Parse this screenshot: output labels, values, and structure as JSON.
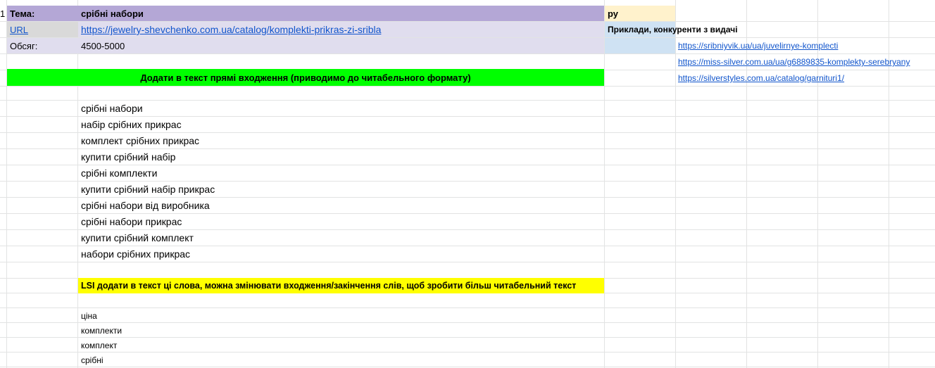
{
  "sheet": {
    "row_number": "1",
    "topic": {
      "label": "Тема:",
      "value": "срібні набори"
    },
    "url": {
      "label": "URL",
      "value": "https://jewelry-shevchenko.com.ua/catalog/komplekti-prikras-zi-sribla"
    },
    "volume": {
      "label": "Обсяг:",
      "value": "4500-5000"
    },
    "lang_label": "ру",
    "competitors": {
      "header": "Приклади, конкуренти з видачі",
      "links": [
        "https://sribniyvik.ua/ua/juvelirnye-komplecti",
        "https://miss-silver.com.ua/ua/g6889835-komplekty-serebryany",
        "https://silverstyles.com.ua/catalog/garnituri1/"
      ]
    },
    "direct_header": "Додати в текст прямі входження (приводимо до читабельного формату)",
    "direct_keywords": [
      "срібні набори",
      "набір срібних прикрас",
      "комплект срібних прикрас",
      "купити срібний набір",
      "срібні комплекти",
      "купити срібний набір прикрас",
      "срібні набори від виробника",
      "срібні набори прикрас",
      "купити срібний комплект",
      "набори срібних прикрас"
    ],
    "lsi_header": "LSI додати в текст ці слова, можна змінювати входження/закінчення слів, щоб зробити більш читабельний текст",
    "lsi_words": [
      "ціна",
      "комплекти",
      "комплект",
      "срібні"
    ]
  },
  "colors": {
    "purple": "#b4a7d6",
    "green": "#00ff00",
    "yellow": "#ffff00",
    "link": "#1155cc",
    "gridline": "#e2e3e3"
  }
}
